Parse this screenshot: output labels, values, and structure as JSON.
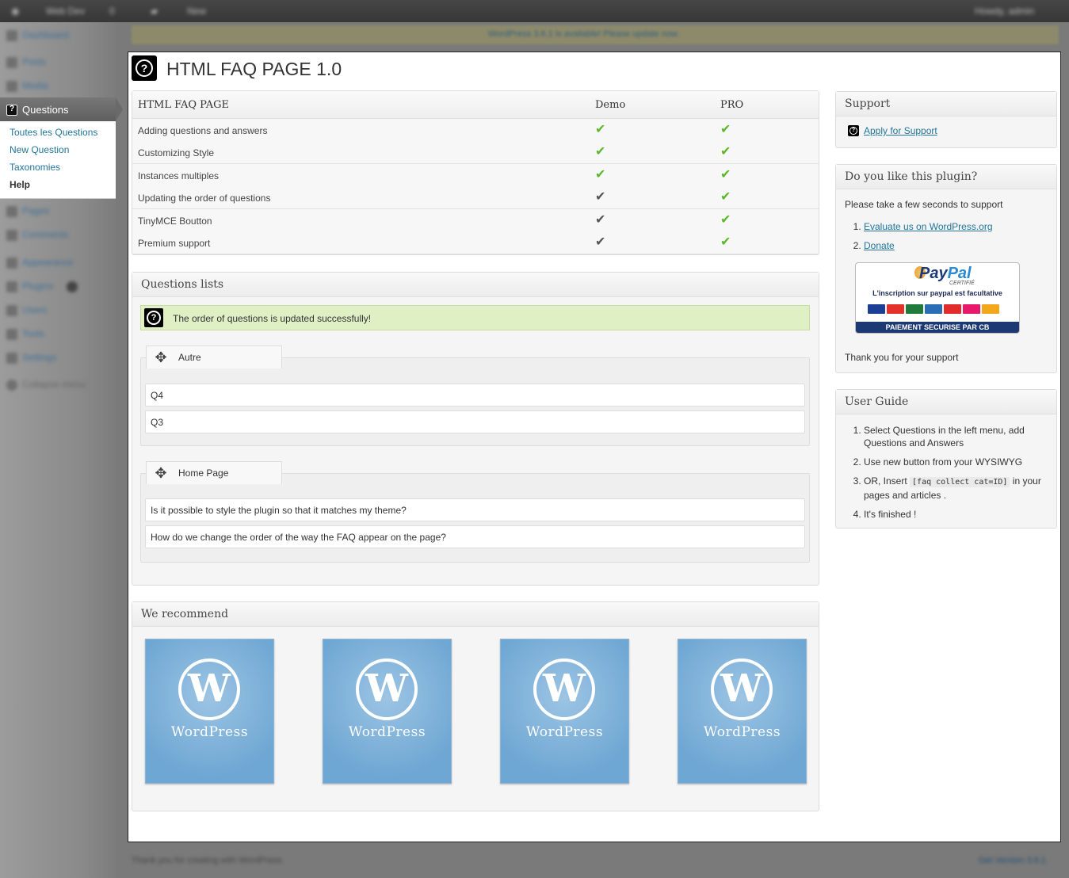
{
  "adminbar": {
    "site": "Web Dev",
    "updates": "0",
    "new": "New",
    "howdy": "Howdy, admin"
  },
  "notice": {
    "text": "WordPress 3.6.1 is available! Please update now."
  },
  "menu": {
    "items_top": [
      "Dashboard",
      "Posts",
      "Media"
    ],
    "questions": {
      "label": "Questions",
      "submenu": [
        "Toutes les Questions",
        "New Question",
        "Taxonomies",
        "Help"
      ]
    },
    "items_bottom": [
      "Pages",
      "Comments",
      "Appearance",
      "Plugins",
      "Users",
      "Tools",
      "Settings",
      "Collapse menu"
    ]
  },
  "page": {
    "title": "HTML FAQ PAGE 1.0"
  },
  "comparison": {
    "headers": [
      "HTML FAQ PAGE",
      "Demo",
      "PRO"
    ],
    "rows": [
      {
        "label": "Adding questions and answers",
        "demo": "green",
        "pro": "green"
      },
      {
        "label": "Customizing Style",
        "demo": "green",
        "pro": "green"
      },
      {
        "label": "Instances multiples",
        "demo": "green",
        "pro": "green"
      },
      {
        "label": "Updating the order of questions",
        "demo": "grey",
        "pro": "green"
      },
      {
        "label": "TinyMCE Boutton",
        "demo": "grey",
        "pro": "green"
      },
      {
        "label": "Premium support",
        "demo": "grey",
        "pro": "green"
      }
    ],
    "check_glyph": "✔"
  },
  "questions_lists": {
    "title": "Questions lists",
    "success": "The order of questions is updated successfully!",
    "groups": [
      {
        "name": "Autre",
        "questions": [
          "Q4",
          "Q3"
        ]
      },
      {
        "name": "Home Page",
        "questions": [
          "Is it possible to style the plugin so that it matches my theme?",
          "How do we change the order of the way the FAQ appear on the page?"
        ]
      }
    ]
  },
  "recommend": {
    "title": "We recommend",
    "logo_letter": "W",
    "label": "WordPress"
  },
  "support": {
    "title": "Support",
    "link": "Apply for Support"
  },
  "like": {
    "title": "Do you like this plugin?",
    "intro": "Please take a few seconds to support",
    "links": [
      "Evaluate us on WordPress.org",
      "Donate"
    ],
    "paypal": {
      "brand_a": "Pay",
      "brand_b": "Pal",
      "certifie": "CERTIFIÉ",
      "tagline": "L'inscription sur paypal est facultative",
      "footer": "PAIEMENT SECURISE PAR CB"
    },
    "thanks": "Thank you for your support"
  },
  "guide": {
    "title": "User Guide",
    "step1": "Select Questions in the left menu, add Questions and Answers",
    "step2": "Use new button from your WYSIWYG",
    "step3_a": "OR, Insert",
    "step3_code": "[faq collect cat=ID]",
    "step3_b": "in your pages and articles .",
    "step4": "It's finished !"
  },
  "footer": {
    "left": "Thank you for creating with WordPress.",
    "right": "Get Version 3.6.1"
  },
  "colors": {
    "accent": "#21759b",
    "check_green": "#5cb82b",
    "success_bg": "#dff0c5"
  }
}
